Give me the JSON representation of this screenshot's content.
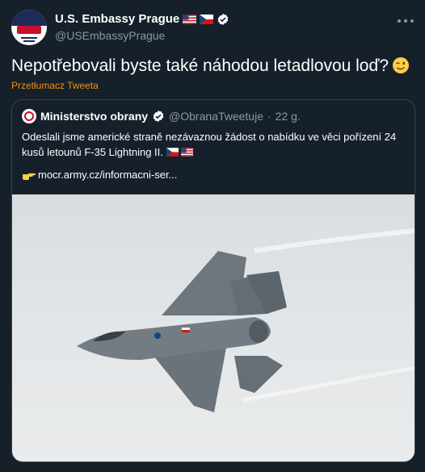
{
  "tweet": {
    "user_name": "U.S. Embassy Prague",
    "handle": "@USEmbassyPrague",
    "text": "Nepotřebovali byste také náhodou letadlovou loď?",
    "translate_label": "Przetłumacz Tweeta"
  },
  "quoted": {
    "name": "Ministerstvo obrany",
    "handle": "@ObranaTweetuje",
    "separator": "·",
    "time": "22 g.",
    "text": "Odeslali jsme americké straně nezávaznou žádost o nabídku ve věci pořízení 24 kusů letounů F-35 Lightning II.",
    "link": "mocr.army.cz/informacni-ser..."
  },
  "icons": {
    "avatar": "embassy-seal-icon",
    "flags": [
      "us-flag-icon",
      "cz-flag-icon"
    ],
    "verified": "verified-badge-icon",
    "more": "more-options-icon",
    "wink": "winking-face-icon",
    "point": "pointing-hand-icon",
    "photo": "f35-jet-photo"
  },
  "colors": {
    "background": "#15202b",
    "secondary_text": "#8899a6",
    "translate": "#f4900c",
    "border": "#38444d",
    "verified": "#ffffff"
  }
}
